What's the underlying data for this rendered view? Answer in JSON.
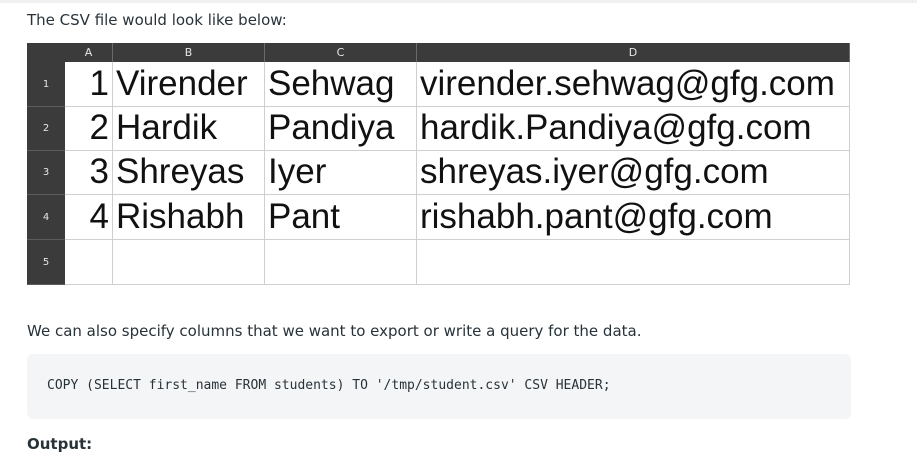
{
  "intro_text": "The CSV file would look like below:",
  "sheet": {
    "columns": [
      "A",
      "B",
      "C",
      "D"
    ],
    "row_numbers": [
      "1",
      "2",
      "3",
      "4",
      "5"
    ],
    "rows": [
      [
        "1",
        "Virender",
        "Sehwag",
        "virender.sehwag@gfg.com"
      ],
      [
        "2",
        "Hardik",
        "Pandiya",
        "hardik.Pandiya@gfg.com"
      ],
      [
        "3",
        "Shreyas",
        "Iyer",
        "shreyas.iyer@gfg.com"
      ],
      [
        "4",
        "Rishabh",
        "Pant",
        "rishabh.pant@gfg.com"
      ],
      [
        "",
        "",
        "",
        ""
      ]
    ],
    "header_color": "#3b3b3b"
  },
  "paragraph": "We can also specify columns that we want to export or write a query for the data.",
  "code": "COPY (SELECT first_name FROM students) TO '/tmp/student.csv' CSV HEADER;",
  "output_label": "Output:"
}
